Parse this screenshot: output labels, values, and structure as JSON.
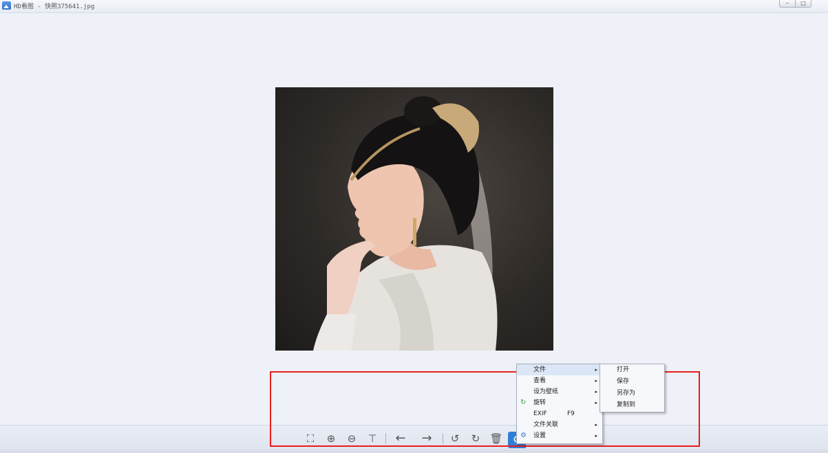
{
  "window": {
    "title": "HD看图 - 快照375641.jpg",
    "buttons": [
      "minimize-button",
      "maximize-button"
    ]
  },
  "toolbar": {
    "tools": [
      {
        "name": "fit-screen-icon",
        "glyph": "⛶"
      },
      {
        "name": "zoom-in-icon",
        "glyph": "⊕"
      },
      {
        "name": "zoom-out-icon",
        "glyph": "⊖"
      },
      {
        "name": "slideshow-icon",
        "glyph": "⊤"
      },
      {
        "name": "prev-icon",
        "glyph": "←"
      },
      {
        "name": "next-icon",
        "glyph": "→"
      },
      {
        "name": "rotate-left-icon",
        "glyph": "↺"
      },
      {
        "name": "rotate-right-icon",
        "glyph": "↻"
      },
      {
        "name": "delete-icon",
        "glyph": "🗑"
      }
    ],
    "settings_icon": "gear-icon"
  },
  "context_menu": {
    "items": [
      {
        "label": "文件",
        "has_submenu": true
      },
      {
        "label": "查看",
        "has_submenu": true
      },
      {
        "label": "设为壁纸",
        "has_submenu": true
      },
      {
        "label": "旋转",
        "has_submenu": true,
        "icon": "refresh-icon"
      },
      {
        "label": "EXIF",
        "shortcut": "F9",
        "has_submenu": false
      },
      {
        "label": "文件关联",
        "has_submenu": true
      },
      {
        "label": "设置",
        "has_submenu": true,
        "icon": "gear-icon"
      }
    ],
    "arrow": "▸",
    "submenu": {
      "items": [
        "打开",
        "保存",
        "另存为",
        "复制到"
      ]
    }
  },
  "highlight_color": "#e81c1c",
  "accent_color": "#2f7fd6"
}
